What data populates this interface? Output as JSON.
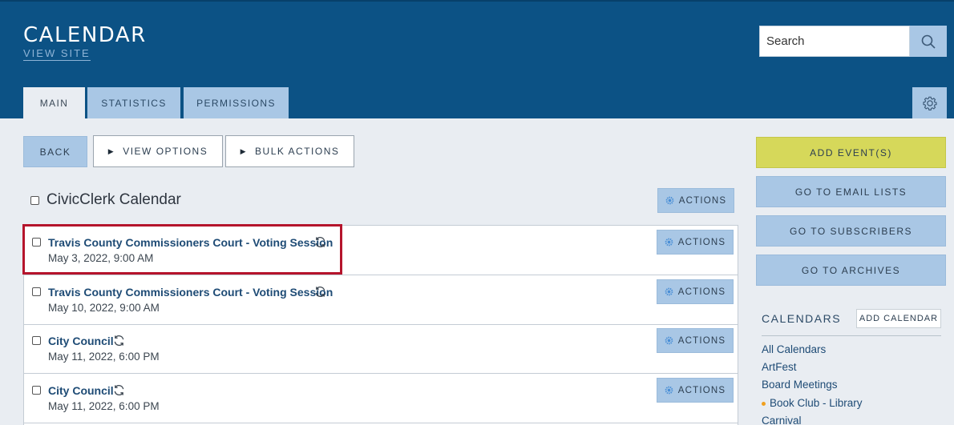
{
  "header": {
    "title": "CALENDAR",
    "view_site": "VIEW SITE",
    "search_placeholder": "Search"
  },
  "tabs": [
    {
      "label": "MAIN",
      "active": true
    },
    {
      "label": "STATISTICS",
      "active": false
    },
    {
      "label": "PERMISSIONS",
      "active": false
    }
  ],
  "toolbar": {
    "back": "BACK",
    "view_options": "VIEW OPTIONS",
    "bulk_actions": "BULK ACTIONS"
  },
  "calendar": {
    "title": "CivicClerk Calendar",
    "actions_label": "ACTIONS"
  },
  "events": [
    {
      "title": "Travis County Commissioners Court - Voting Session",
      "date": "May 3, 2022, 9:00 AM",
      "actions": "ACTIONS",
      "highlighted": true
    },
    {
      "title": "Travis County Commissioners Court - Voting Session",
      "date": "May 10, 2022, 9:00 AM",
      "actions": "ACTIONS"
    },
    {
      "title": "City Council",
      "date": "May 11, 2022, 6:00 PM",
      "actions": "ACTIONS"
    },
    {
      "title": "City Council",
      "date": "May 11, 2022, 6:00 PM",
      "actions": "ACTIONS"
    }
  ],
  "sidebar": {
    "add_events": "ADD EVENT(S)",
    "email_lists": "GO TO EMAIL LISTS",
    "subscribers": "GO TO SUBSCRIBERS",
    "archives": "GO TO ARCHIVES",
    "calendars_heading": "CALENDARS",
    "add_calendar": "ADD CALENDAR",
    "calendars": [
      {
        "label": "All Calendars"
      },
      {
        "label": "ArtFest"
      },
      {
        "label": "Board Meetings"
      },
      {
        "label": "Book Club - Library",
        "dot": true
      },
      {
        "label": "Carnival"
      }
    ]
  },
  "colors": {
    "header_bg": "#0c5285",
    "button_blue": "#a9c7e5",
    "add_events_yellow": "#d6d85a",
    "highlight_red": "#b5142c",
    "link_blue": "#1e4b75"
  }
}
